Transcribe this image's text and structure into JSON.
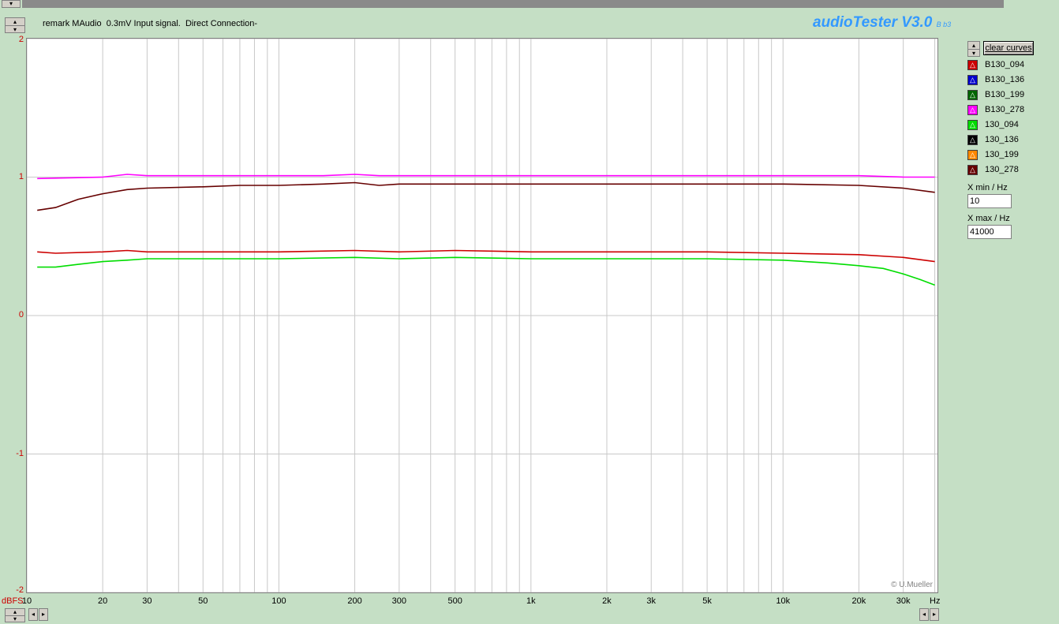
{
  "remark": "remark MAudio  0.3mV Input signal.  Direct Connection-",
  "app_title": "audioTester V3.0",
  "app_version_suffix": "B b3",
  "copyright": "© U.Mueller",
  "clear_curves_label": "clear curves",
  "xmin": {
    "label": "X min / Hz",
    "value": "10"
  },
  "xmax": {
    "label": "X max / Hz",
    "value": "41000"
  },
  "legend": [
    {
      "name": "B130_094",
      "color": "#cc0000"
    },
    {
      "name": "B130_136",
      "color": "#0000cc"
    },
    {
      "name": "B130_199",
      "color": "#006600"
    },
    {
      "name": "B130_278",
      "color": "#ff00ff"
    },
    {
      "name": "130_094",
      "color": "#00dd00"
    },
    {
      "name": "130_136",
      "color": "#000000"
    },
    {
      "name": "130_199",
      "color": "#ff8800"
    },
    {
      "name": "130_278",
      "color": "#660000"
    }
  ],
  "chart_data": {
    "type": "line",
    "xscale": "log",
    "xlabel": "Hz",
    "ylabel": "dBFS",
    "xlim": [
      10,
      41000
    ],
    "ylim": [
      -2,
      2
    ],
    "grid": true,
    "x_ticks": [
      {
        "v": 10,
        "label": "10"
      },
      {
        "v": 20,
        "label": "20"
      },
      {
        "v": 30,
        "label": "30"
      },
      {
        "v": 50,
        "label": "50"
      },
      {
        "v": 100,
        "label": "100"
      },
      {
        "v": 200,
        "label": "200"
      },
      {
        "v": 300,
        "label": "300"
      },
      {
        "v": 500,
        "label": "500"
      },
      {
        "v": 1000,
        "label": "1k"
      },
      {
        "v": 2000,
        "label": "2k"
      },
      {
        "v": 3000,
        "label": "3k"
      },
      {
        "v": 5000,
        "label": "5k"
      },
      {
        "v": 10000,
        "label": "10k"
      },
      {
        "v": 20000,
        "label": "20k"
      },
      {
        "v": 30000,
        "label": "30k"
      }
    ],
    "y_ticks": [
      {
        "v": 2,
        "label": "2"
      },
      {
        "v": 1,
        "label": "1"
      },
      {
        "v": 0,
        "label": "0"
      },
      {
        "v": -1,
        "label": "-1"
      },
      {
        "v": -2,
        "label": "-2"
      }
    ],
    "series": [
      {
        "name": "B130_278",
        "color": "#ff00ff",
        "x": [
          11,
          20,
          25,
          30,
          50,
          70,
          100,
          150,
          200,
          250,
          300,
          500,
          1000,
          2000,
          5000,
          10000,
          20000,
          30000,
          40000
        ],
        "y": [
          0.99,
          1.0,
          1.02,
          1.01,
          1.01,
          1.01,
          1.01,
          1.01,
          1.02,
          1.01,
          1.01,
          1.01,
          1.01,
          1.01,
          1.01,
          1.01,
          1.01,
          1.0,
          1.0
        ]
      },
      {
        "name": "130_278",
        "color": "#660000",
        "x": [
          11,
          13,
          16,
          20,
          25,
          30,
          50,
          70,
          100,
          150,
          200,
          250,
          300,
          500,
          1000,
          2000,
          5000,
          10000,
          20000,
          30000,
          40000
        ],
        "y": [
          0.76,
          0.78,
          0.84,
          0.88,
          0.91,
          0.92,
          0.93,
          0.94,
          0.94,
          0.95,
          0.96,
          0.94,
          0.95,
          0.95,
          0.95,
          0.95,
          0.95,
          0.95,
          0.94,
          0.92,
          0.89
        ]
      },
      {
        "name": "B130_094",
        "color": "#cc0000",
        "x": [
          11,
          13,
          20,
          25,
          30,
          50,
          100,
          200,
          300,
          500,
          1000,
          2000,
          5000,
          10000,
          20000,
          30000,
          40000
        ],
        "y": [
          0.46,
          0.45,
          0.46,
          0.47,
          0.46,
          0.46,
          0.46,
          0.47,
          0.46,
          0.47,
          0.46,
          0.46,
          0.46,
          0.45,
          0.44,
          0.42,
          0.39
        ]
      },
      {
        "name": "130_094",
        "color": "#00dd00",
        "x": [
          11,
          13,
          16,
          20,
          25,
          30,
          50,
          100,
          200,
          300,
          500,
          1000,
          2000,
          5000,
          10000,
          15000,
          20000,
          25000,
          30000,
          35000,
          40000
        ],
        "y": [
          0.35,
          0.35,
          0.37,
          0.39,
          0.4,
          0.41,
          0.41,
          0.41,
          0.42,
          0.41,
          0.42,
          0.41,
          0.41,
          0.41,
          0.4,
          0.38,
          0.36,
          0.34,
          0.3,
          0.26,
          0.22
        ]
      }
    ]
  }
}
